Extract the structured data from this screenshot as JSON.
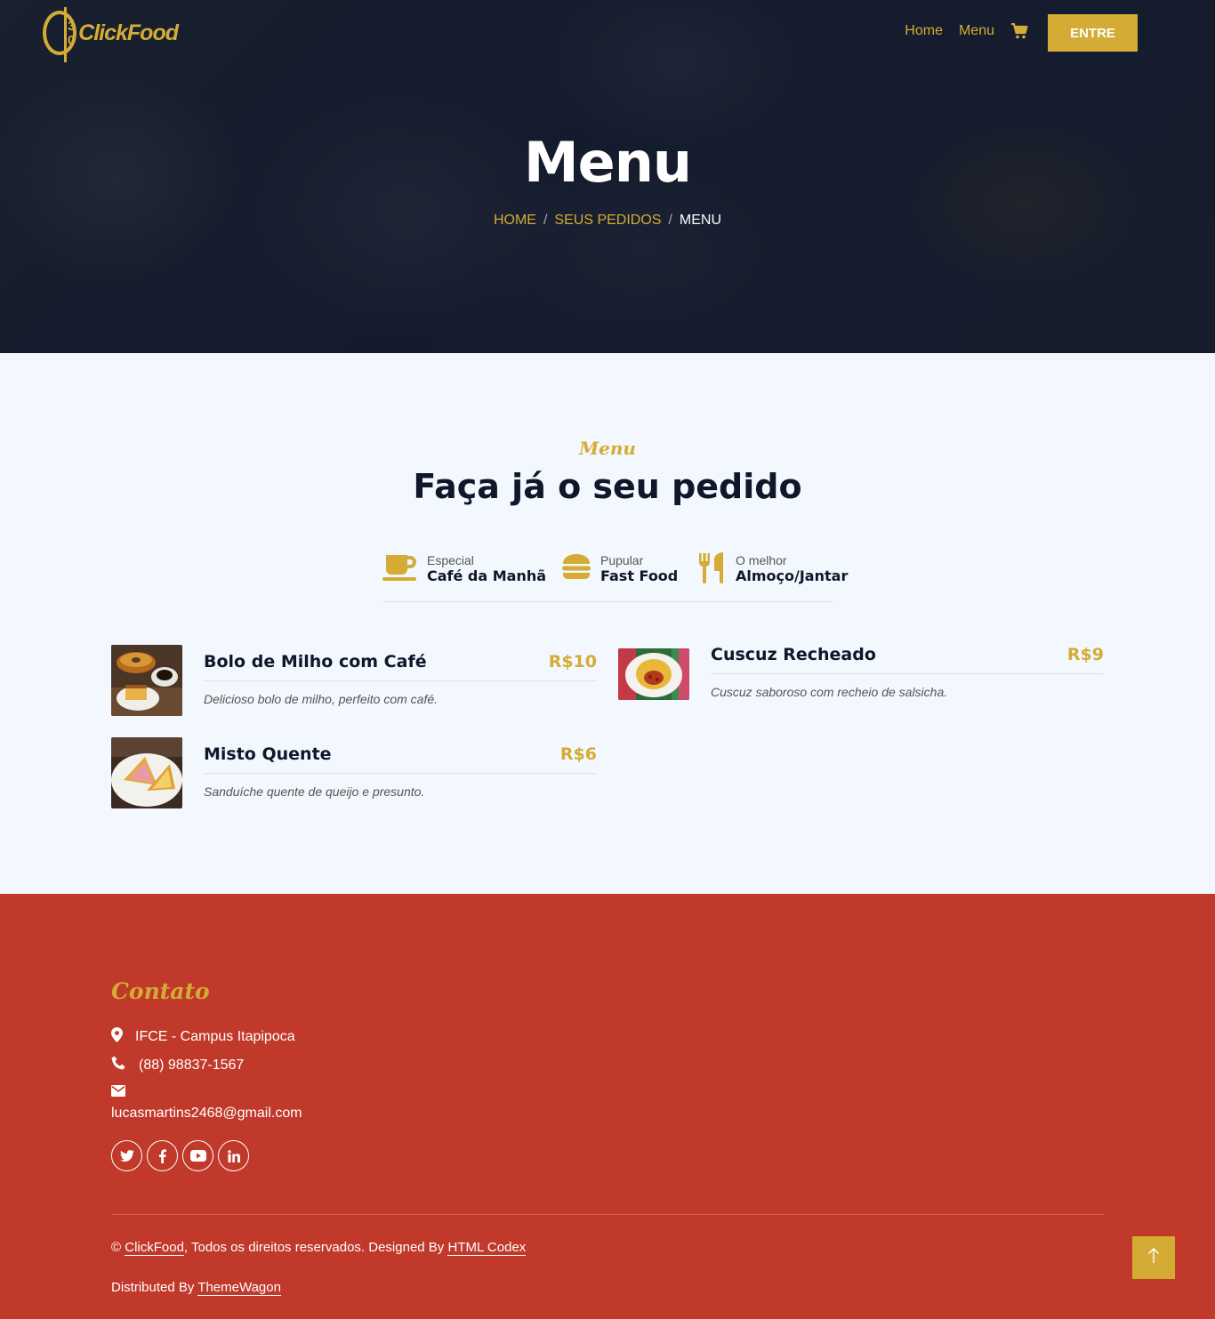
{
  "brand": {
    "logo_mark": "3 0",
    "name": "ClickFood"
  },
  "nav": {
    "items": [
      {
        "label": "Home"
      },
      {
        "label": "Menu"
      }
    ],
    "cart_icon": "cart-icon",
    "login_label": "ENTRE"
  },
  "hero": {
    "title": "Menu",
    "breadcrumb": [
      {
        "label": "HOME"
      },
      {
        "label": "SEUS PEDIDOS"
      },
      {
        "label": "MENU"
      }
    ],
    "separator": "/"
  },
  "menu": {
    "subtitle": "Menu",
    "title": "Faça já o seu pedido",
    "tabs": [
      {
        "icon": "coffee-icon",
        "small": "Especial",
        "big": "Café da Manhã"
      },
      {
        "icon": "hamburger-icon",
        "small": "Pupular",
        "big": "Fast Food"
      },
      {
        "icon": "utensils-icon",
        "small": "O melhor",
        "big": "Almoço/Jantar"
      }
    ],
    "items": [
      {
        "name": "Bolo de Milho com Café",
        "price": "R$10",
        "desc": "Delicioso bolo de milho, perfeito com café."
      },
      {
        "name": "Misto Quente",
        "price": "R$6",
        "desc": "Sanduíche quente de queijo e presunto."
      },
      {
        "name": "Cuscuz Recheado",
        "price": "R$9",
        "desc": "Cuscuz saboroso com recheio de salsicha."
      }
    ]
  },
  "footer": {
    "title": "Contato",
    "address": "IFCE - Campus Itapipoca",
    "phone": "(88) 98837-1567",
    "email": "lucasmartins2468@gmail.com",
    "socials": [
      "twitter-icon",
      "facebook-icon",
      "youtube-icon",
      "linkedin-icon"
    ],
    "copyright_prefix": "©",
    "copyright_brand": "ClickFood",
    "copyright_mid": ", Todos os direitos reservados. Designed By",
    "copyright_link": "HTML Codex",
    "distributed_prefix": "Distributed By",
    "distributed_link": "ThemeWagon",
    "back_to_top_icon": "arrow-up-icon"
  },
  "colors": {
    "accent": "#d4ac35",
    "dark": "#0f172b",
    "footer_bg": "#c1392b",
    "section_bg": "#f2f8fd"
  }
}
